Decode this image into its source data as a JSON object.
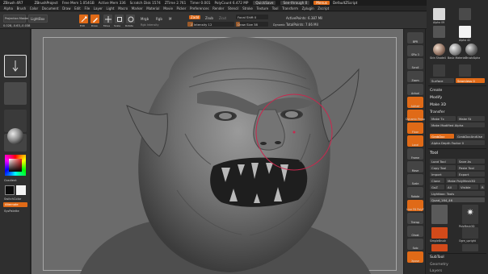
{
  "titlebar": {
    "app": "ZBrush 4R7",
    "project": "ZBrushProject",
    "stats": [
      "Free Mem 1.054GB",
      "Active Mem 336",
      "Scratch Disk 1574",
      "ZTime 2.761",
      "Timer 0.001",
      "PolyCount 6.472 MP"
    ],
    "quicksave": "QuickSave",
    "seethrough": "See-through 0",
    "menus_label": "Menus",
    "defaultscript": "DefaultZScript"
  },
  "menubar": {
    "items": [
      "Alpha",
      "Brush",
      "Color",
      "Document",
      "Draw",
      "Edit",
      "File",
      "Layer",
      "Light",
      "Macro",
      "Marker",
      "Material",
      "Movie",
      "Picker",
      "Preferences",
      "Render",
      "Stencil",
      "Stroke",
      "Texture",
      "Tool",
      "Transform",
      "Zplugin",
      "Zscript"
    ]
  },
  "toolbar": {
    "projection_master": "Projection Master",
    "lightbox": "LightBox",
    "edit": "Edit",
    "draw": "Draw",
    "move": "Move",
    "scale": "Scale",
    "rotate": "Rotate",
    "mrgb": "Mrgb",
    "rgb": "Rgb",
    "m": "M",
    "zadd": "Zadd",
    "zsub": "Zsub",
    "zcut": "Zcut",
    "rgb_intensity": "Rgb Intensity",
    "z_intensity": "Z Intensity 12",
    "focal_shift": "Focal Shift 0",
    "draw_size": "Draw Size 38",
    "dynamic": "Dynamic",
    "active_points": "ActivePoints: 6.387 Mil",
    "total_points": "TotalPoints: 7.66 Mil",
    "coords": "0.028,-0.63,-0.038",
    "z_intensity_value": 12,
    "draw_size_value": 38
  },
  "leftshelf": {
    "gradient": "Gradient",
    "switchcolor": "SwitchColor",
    "alternate": "Alternate",
    "syspalette": "SysPalette"
  },
  "rightshelf": {
    "buttons": [
      "BPR",
      "SPix 3",
      "Scroll",
      "Zoom",
      "Actual",
      "AAHalf",
      "Dynamic Persp",
      "Floor",
      "Local",
      "Frame",
      "Move",
      "Scale",
      "Rotate",
      "Line Fill PolyF",
      "Transp",
      "Ghost",
      "Solo",
      "Xpose"
    ]
  },
  "tray": {
    "materials": [
      "Alpha 09",
      "Alpha 42",
      "Skin Shade4",
      "Basic Material",
      "BrushAlpha"
    ],
    "surface": "Surface",
    "seamless": "Seamless 0",
    "create": "Create",
    "modify": "Modify",
    "make3d": "Make 3D",
    "transfer": "Transfer",
    "make_tx": "Make Tx",
    "make_st": "Make St",
    "make_modified_alpha": "Make Modified Alpha",
    "depth_factor": "Alpha Depth Factor 0",
    "grabdoc": "GrabDoc",
    "grabdoc_and_use": "GrabDocAndUse",
    "tool_title": "Tool",
    "load_tool": "Load Tool",
    "save_as": "Save As",
    "copy_tool": "Copy Tool",
    "paste_tool": "Paste Tool",
    "import": "Import",
    "export": "Export",
    "clone": "Clone",
    "make_polymesh": "Make PolyMesh3D",
    "goz": "GoZ",
    "all": "All",
    "visible": "Visible",
    "r": "R",
    "lightbox_tools": "Lightbox: Tools",
    "tool_name": "Quad_164_46",
    "tools": [
      "Ogre_head",
      "PolyMesh3D",
      "SimpleBrush",
      "ZSphere",
      "Ogre_upright"
    ],
    "subtool": "SubTool",
    "geometry": "Geometry",
    "layers": "Layers"
  }
}
